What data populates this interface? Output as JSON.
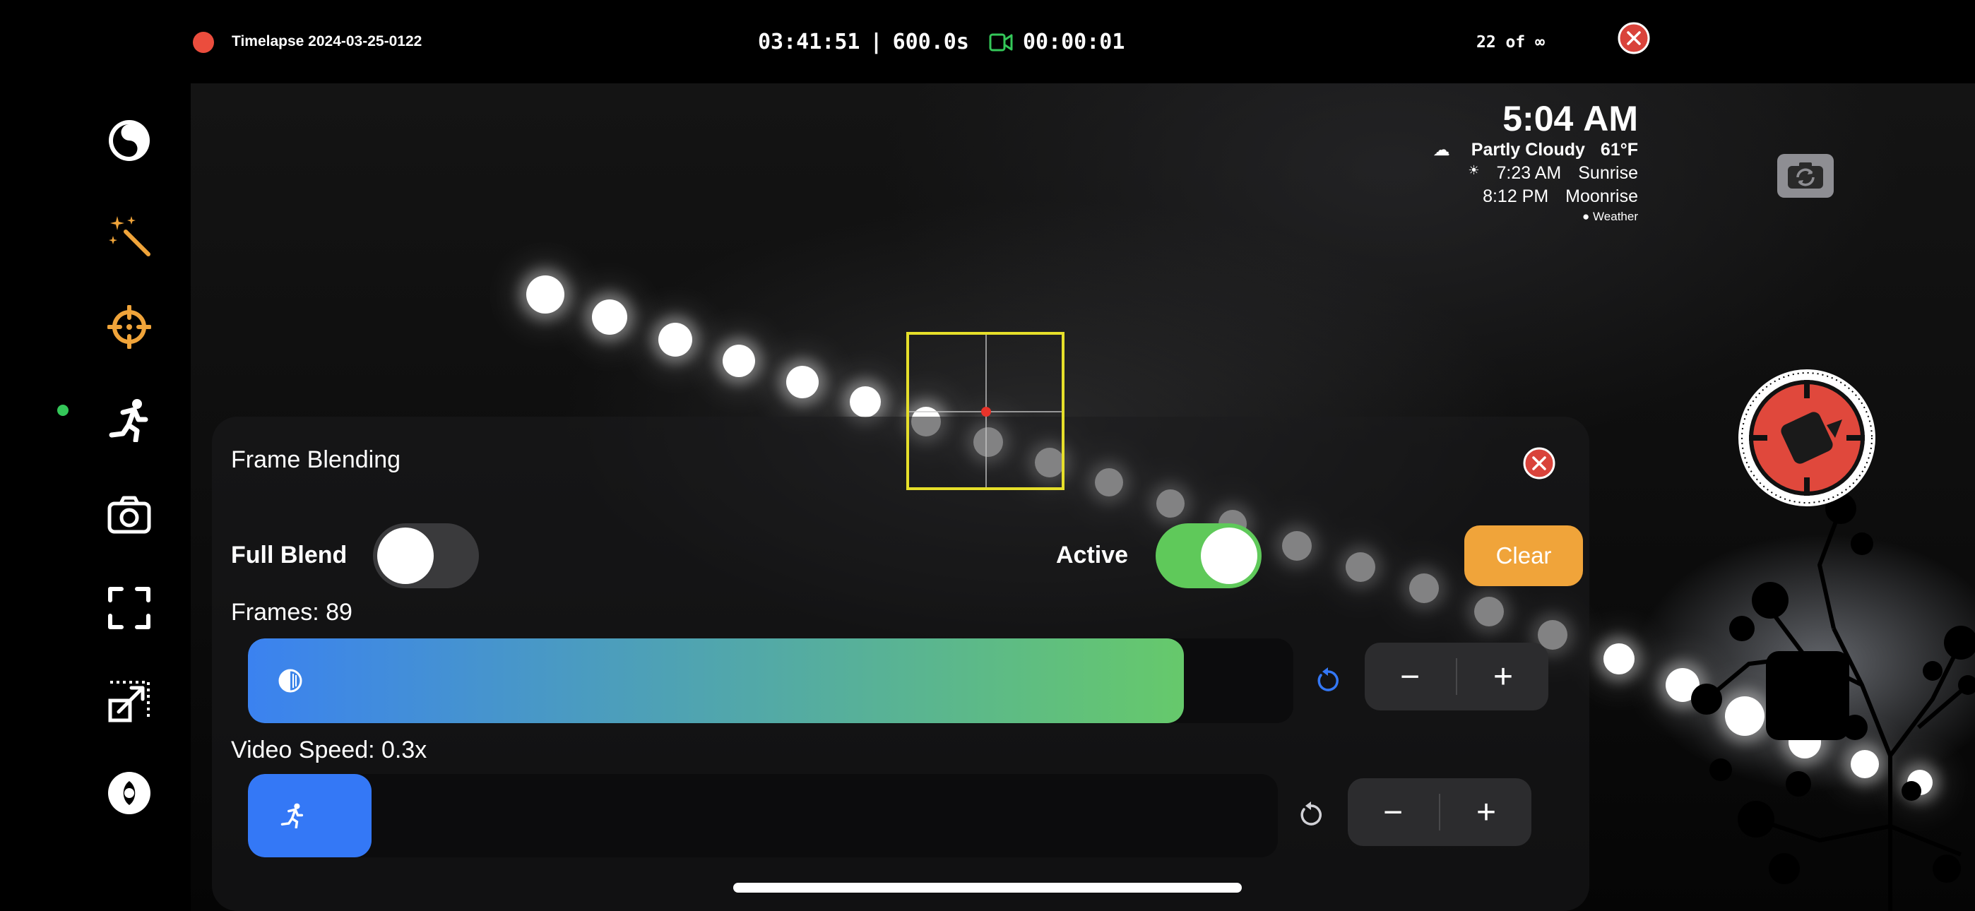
{
  "status_bar": {
    "record_title": "Timelapse 2024-03-25-0122",
    "record_color": "#eb4d3d",
    "elapsed": "03:41:51",
    "separator": "|",
    "interval": "600.0s",
    "video_icon": "video-camera-icon",
    "video_time": "00:00:01",
    "frame_count": "22 of ∞",
    "close_icon": "close-circle-icon"
  },
  "weather": {
    "time": "5:04",
    "ampm": "AM",
    "condition": "Partly Cloudy",
    "temperature": "61°F",
    "sunrise_time": "7:23 AM",
    "sunrise_label": "Sunrise",
    "moonrise_time": "8:12 PM",
    "moonrise_label": "Moonrise",
    "attribution": "Weather"
  },
  "sidebar": {
    "items": [
      {
        "icon": "yin-yang-icon"
      },
      {
        "icon": "magic-wand-icon"
      },
      {
        "icon": "crosshair-icon"
      },
      {
        "icon": "running-figure-icon",
        "active": true
      },
      {
        "icon": "camera-icon"
      },
      {
        "icon": "frame-corners-icon"
      },
      {
        "icon": "resize-arrow-icon"
      },
      {
        "icon": "eye-icon"
      }
    ]
  },
  "panel": {
    "title": "Frame Blending",
    "full_blend_label": "Full Blend",
    "full_blend_on": false,
    "active_label": "Active",
    "active_on": true,
    "clear_label": "Clear",
    "frames_label": "Frames: 89",
    "frames_fill": 0.895,
    "video_speed_label": "Video Speed: 0.3x",
    "video_speed_fill": 0.12,
    "minus": "−",
    "plus": "+"
  },
  "colors": {
    "accent_orange": "#f0a43a",
    "toggle_green": "#5fc95a",
    "accent_blue": "#3478f6",
    "gradient_start": "#3b82f0",
    "gradient_end": "#66c96b",
    "focus_yellow": "#e6df2a",
    "shutter_red": "#e0483c",
    "close_red": "#d9433b"
  }
}
